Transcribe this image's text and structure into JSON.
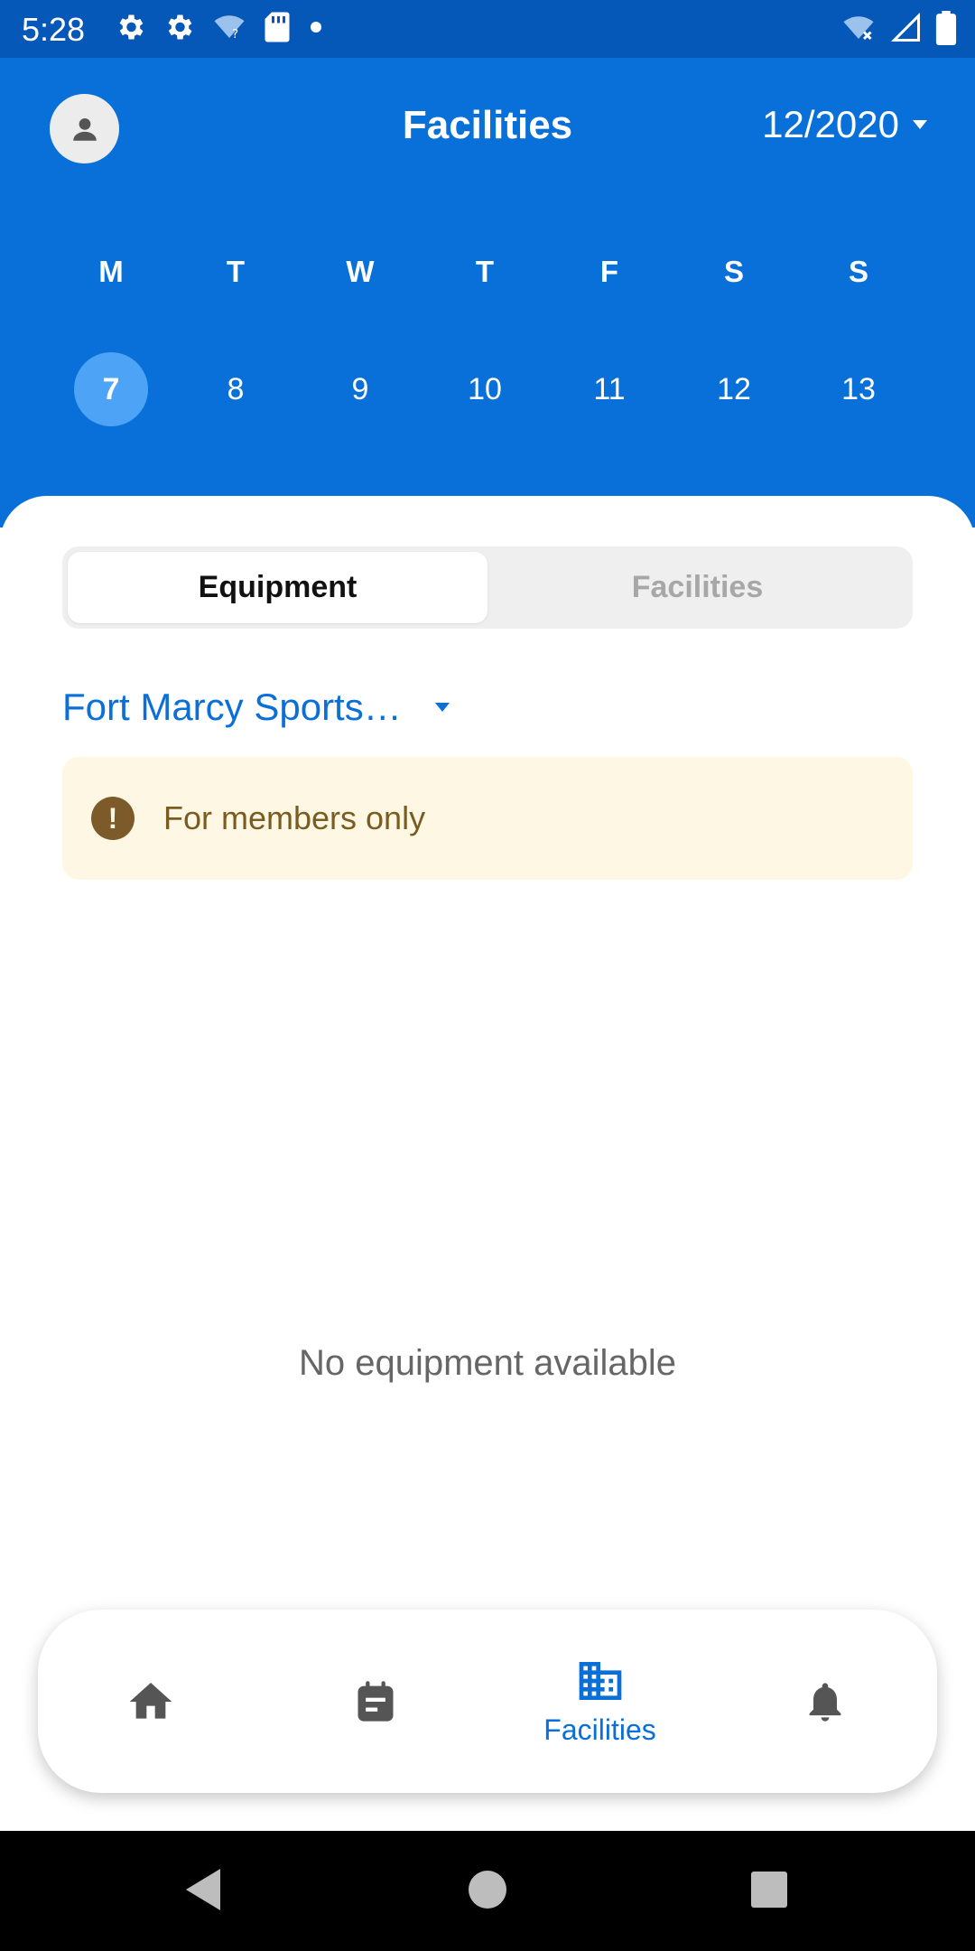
{
  "status_bar": {
    "time": "5:28",
    "left_icons": [
      "settings-icon",
      "settings-icon",
      "wifi-question-icon",
      "sd-card-icon",
      "dot-icon"
    ],
    "right_icons": [
      "wifi-x-icon",
      "signal-icon",
      "battery-icon"
    ]
  },
  "header": {
    "title": "Facilities",
    "month": "12/2020",
    "weekdays": [
      "M",
      "T",
      "W",
      "T",
      "F",
      "S",
      "S"
    ],
    "dates": [
      "7",
      "8",
      "9",
      "10",
      "11",
      "12",
      "13"
    ],
    "selected_date": "7"
  },
  "segment": {
    "tabs": [
      {
        "label": "Equipment",
        "active": true
      },
      {
        "label": "Facilities",
        "active": false
      }
    ]
  },
  "location": {
    "selected": "Fort Marcy Sports…"
  },
  "notice": {
    "text": "For members only"
  },
  "empty_state": {
    "text": "No equipment available"
  },
  "bottom_nav": {
    "items": [
      {
        "icon": "home-icon",
        "label": ""
      },
      {
        "icon": "calendar-icon",
        "label": ""
      },
      {
        "icon": "building-icon",
        "label": "Facilities",
        "active": true
      },
      {
        "icon": "bell-icon",
        "label": ""
      }
    ]
  },
  "colors": {
    "header_blue": "#0870d8",
    "status_blue": "#0557b8",
    "accent": "#0a6fd6",
    "selected_date": "#4da3f5",
    "notice_bg": "#fdf7e4",
    "notice_text": "#7a5c22"
  }
}
